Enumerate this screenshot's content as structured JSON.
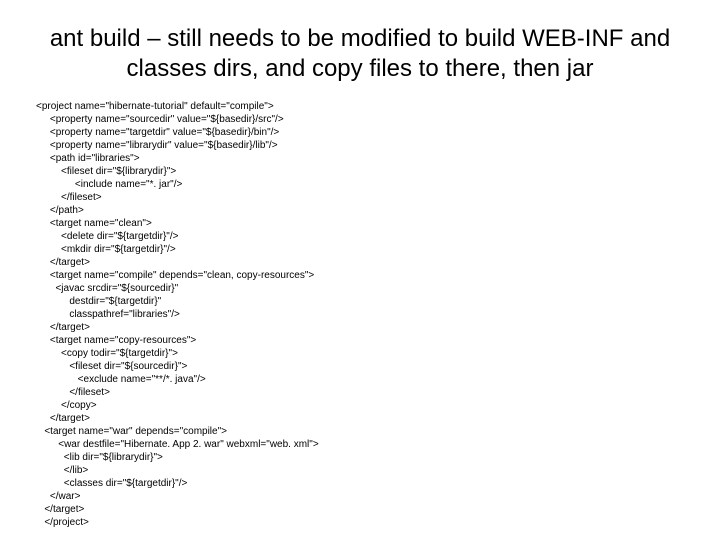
{
  "title": "ant build – still needs to be modified to build WEB-INF and classes dirs, and copy files to there, then jar",
  "code": "<project name=\"hibernate-tutorial\" default=\"compile\">\n     <property name=\"sourcedir\" value=\"${basedir}/src\"/>\n     <property name=\"targetdir\" value=\"${basedir}/bin\"/>\n     <property name=\"librarydir\" value=\"${basedir}/lib\"/>\n     <path id=\"libraries\">\n         <fileset dir=\"${librarydir}\">\n              <include name=\"*. jar\"/>\n         </fileset>\n     </path>\n     <target name=\"clean\">\n         <delete dir=\"${targetdir}\"/>\n         <mkdir dir=\"${targetdir}\"/>\n     </target>\n     <target name=\"compile\" depends=\"clean, copy-resources\">\n       <javac srcdir=\"${sourcedir}\"\n            destdir=\"${targetdir}\"\n            classpathref=\"libraries\"/>\n     </target>\n     <target name=\"copy-resources\">\n         <copy todir=\"${targetdir}\">\n            <fileset dir=\"${sourcedir}\">\n               <exclude name=\"**/*. java\"/>\n            </fileset>\n         </copy>\n     </target>\n   <target name=\"war\" depends=\"compile\">\n        <war destfile=\"Hibernate. App 2. war\" webxml=\"web. xml\">\n          <lib dir=\"${librarydir}\">\n          </lib>\n          <classes dir=\"${targetdir}\"/>\n     </war>\n   </target>\n   </project>"
}
